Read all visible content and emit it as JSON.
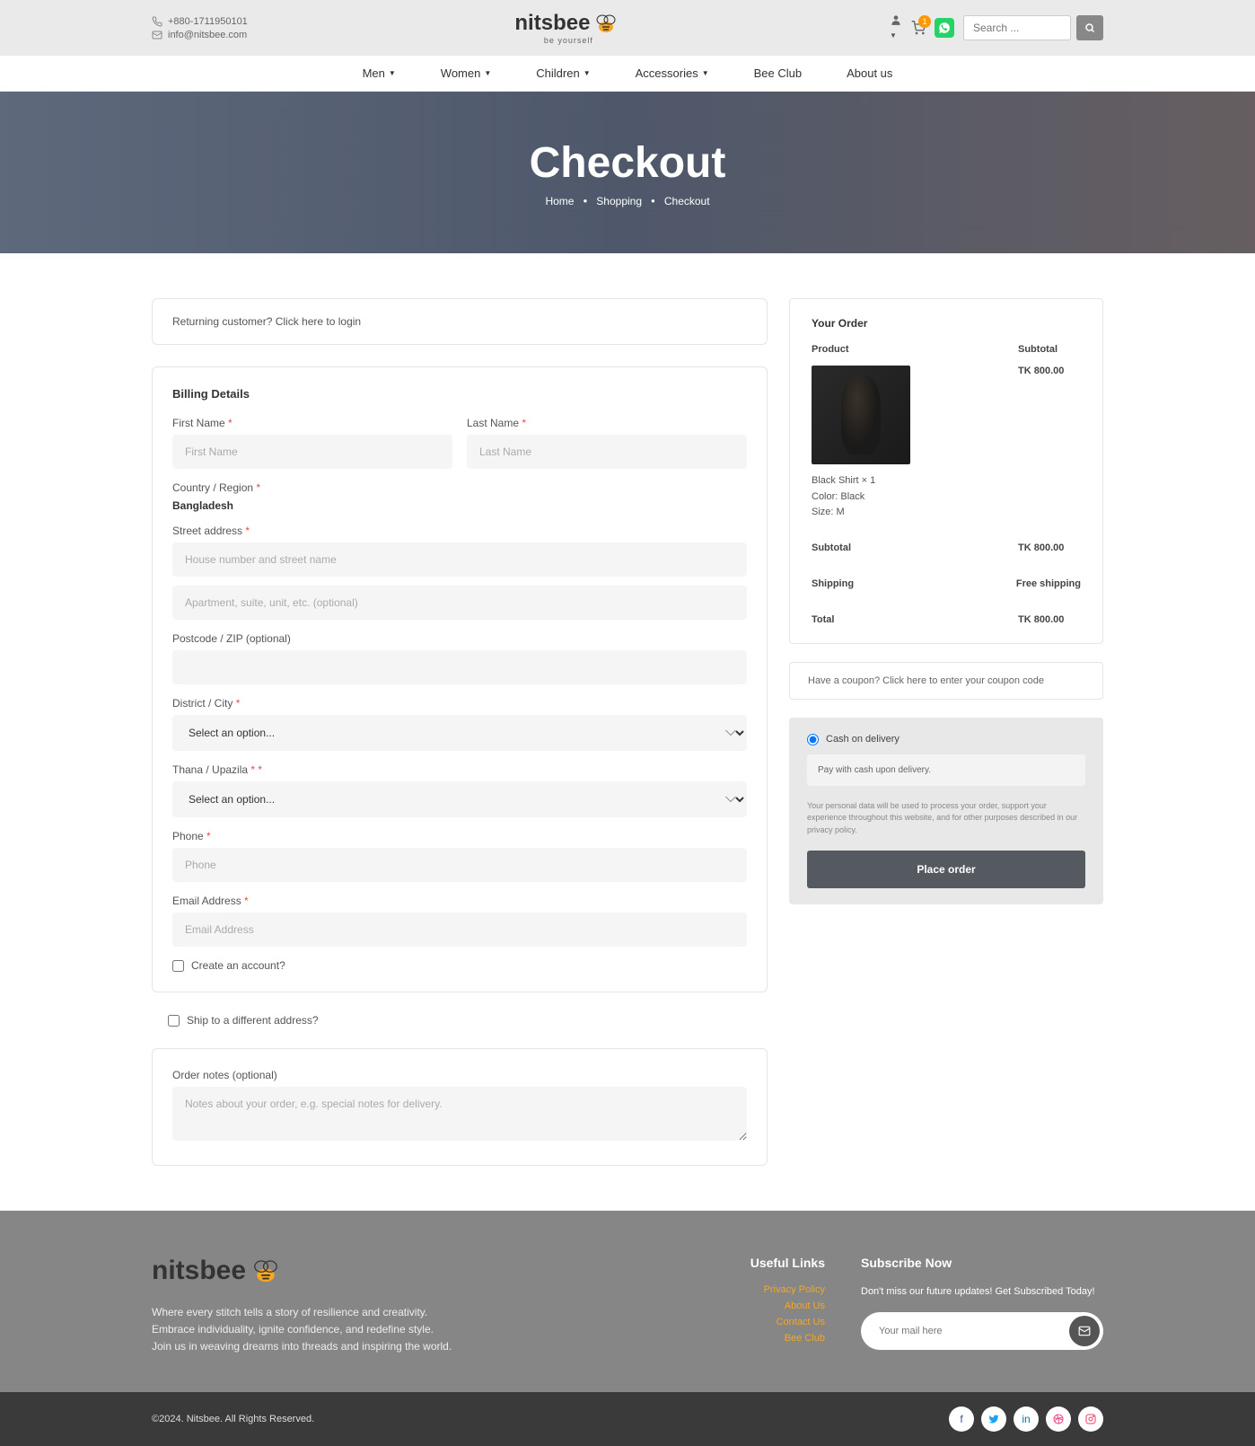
{
  "topbar": {
    "phone": "+880-1711950101",
    "email": "info@nitsbee.com",
    "logo_main": "nitsbee",
    "logo_sub": "be yourself",
    "cart_count": "1",
    "search_placeholder": "Search ..."
  },
  "nav": {
    "items": [
      "Men",
      "Women",
      "Children",
      "Accessories",
      "Bee Club",
      "About us"
    ]
  },
  "hero": {
    "title": "Checkout",
    "crumb1": "Home",
    "crumb2": "Shopping",
    "crumb3": "Checkout"
  },
  "returning": "Returning customer? Click here to login",
  "billing": {
    "title": "Billing Details",
    "first_name_label": "First Name",
    "first_name_ph": "First Name",
    "last_name_label": "Last Name",
    "last_name_ph": "Last Name",
    "country_label": "Country / Region",
    "country_value": "Bangladesh",
    "street_label": "Street address",
    "street_ph1": "House number and street name",
    "street_ph2": "Apartment, suite, unit, etc. (optional)",
    "postcode_label": "Postcode / ZIP (optional)",
    "district_label": "District / City",
    "district_ph": "Select an option...",
    "thana_label": "Thana / Upazila",
    "thana_ph": "Select an option...",
    "phone_label": "Phone",
    "phone_ph": "Phone",
    "email_label": "Email Address",
    "email_ph": "Email Address",
    "create_account": "Create an account?"
  },
  "ship_diff": "Ship to a different address?",
  "notes": {
    "label": "Order notes (optional)",
    "ph": "Notes about your order, e.g. special notes for delivery."
  },
  "order": {
    "title": "Your Order",
    "head_product": "Product",
    "head_subtotal": "Subtotal",
    "item_name": "Black Shirt  × 1",
    "item_color": "Color: Black",
    "item_size": "Size: M",
    "item_price": "TK  800.00",
    "subtotal_label": "Subtotal",
    "subtotal_val": "TK  800.00",
    "shipping_label": "Shipping",
    "shipping_val": "Free shipping",
    "total_label": "Total",
    "total_val": "TK  800.00"
  },
  "coupon": "Have a coupon? Click here to enter your coupon code",
  "payment": {
    "cod_label": "Cash on delivery",
    "cod_desc": "Pay with cash upon delivery.",
    "privacy": "Your personal data will be used to process your order, support your experience throughout this website, and for other purposes described in our privacy policy.",
    "place_order": "Place order"
  },
  "footer": {
    "desc": "Where every stitch tells a story of resilience and creativity.\nEmbrace individuality, ignite confidence, and redefine style.\nJoin us in weaving dreams into threads and inspiring the world.",
    "useful_title": "Useful Links",
    "links": [
      "Privacy Policy",
      "About Us",
      "Contact Us",
      "Bee Club"
    ],
    "sub_title": "Subscribe Now",
    "sub_desc": "Don't miss our future updates! Get Subscribed Today!",
    "sub_ph": "Your mail here",
    "copy": "©2024. Nitsbee. All Rights Reserved."
  }
}
